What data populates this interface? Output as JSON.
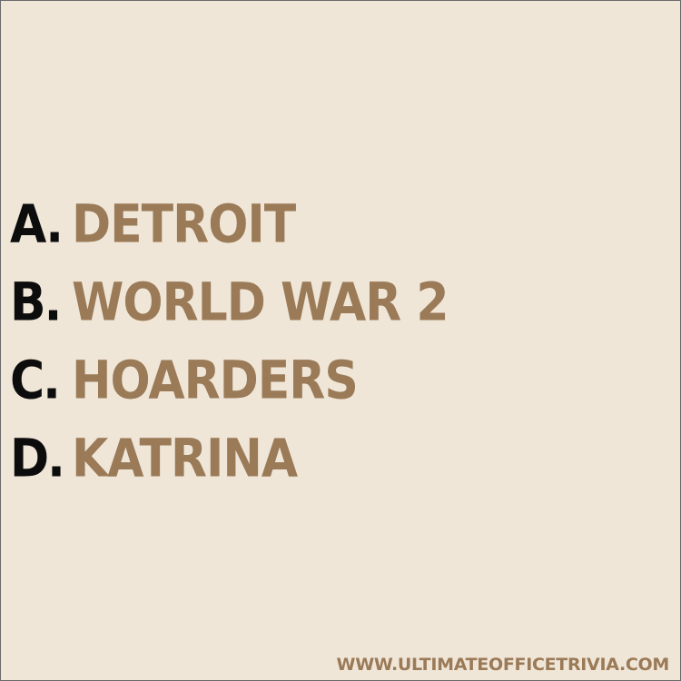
{
  "answers": [
    {
      "letter": "A.",
      "text": "DETROIT"
    },
    {
      "letter": "B.",
      "text": "WORLD WAR 2"
    },
    {
      "letter": "C.",
      "text": "HOARDERS"
    },
    {
      "letter": "D.",
      "text": "KATRINA"
    }
  ],
  "footer": {
    "url": "WWW.ULTIMATEOFFICETRIVIA.COM"
  },
  "colors": {
    "background": "#f0e6d8",
    "letter": "#0c0c0c",
    "answer_text": "#9a7a57",
    "footer_text": "#9a7a57"
  }
}
